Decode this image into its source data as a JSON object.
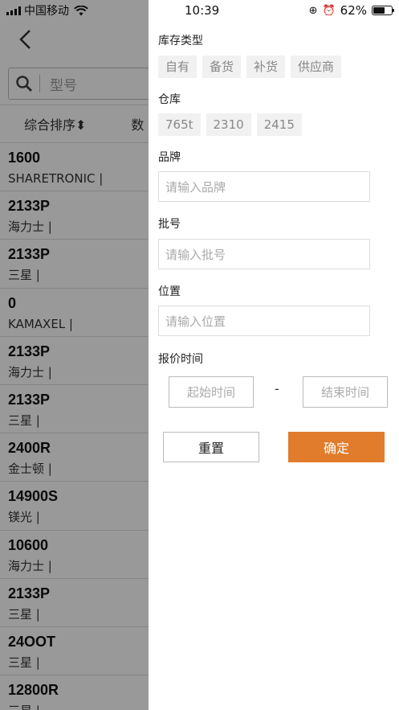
{
  "status_bar": {
    "carrier": "中国移动",
    "time": "10:39",
    "battery": "62%",
    "battery_level": 0.62
  },
  "search": {
    "placeholder": "型号"
  },
  "sort_bar": {
    "primary": "综合排序",
    "secondary": "数"
  },
  "list": [
    {
      "model": "1600",
      "brand": "SHARETRONIC |"
    },
    {
      "model": "2133P",
      "brand": "海力士 |"
    },
    {
      "model": "2133P",
      "brand": "三星 |"
    },
    {
      "model": "0",
      "brand": "KAMAXEL |"
    },
    {
      "model": "2133P",
      "brand": "海力士 |"
    },
    {
      "model": "2133P",
      "brand": "三星 |"
    },
    {
      "model": "2400R",
      "brand": "金士顿 |"
    },
    {
      "model": "14900S",
      "brand": "镁光 |"
    },
    {
      "model": "10600",
      "brand": "海力士 |"
    },
    {
      "model": "2133P",
      "brand": "三星 |"
    },
    {
      "model": "24OOT",
      "brand": "三星 |"
    },
    {
      "model": "12800R",
      "brand": "三星 |"
    }
  ],
  "filter": {
    "stock_type": {
      "title": "库存类型",
      "options": [
        "自有",
        "备货",
        "补货",
        "供应商"
      ]
    },
    "warehouse": {
      "title": "仓库",
      "options": [
        "765t",
        "2310",
        "2415"
      ]
    },
    "brand": {
      "title": "品牌",
      "placeholder": "请输入品牌"
    },
    "batch": {
      "title": "批号",
      "placeholder": "请输入批号"
    },
    "location": {
      "title": "位置",
      "placeholder": "请输入位置"
    },
    "quote_time": {
      "title": "报价时间",
      "start": "起始时间",
      "separator": "-",
      "end": "结束时间"
    },
    "reset_label": "重置",
    "confirm_label": "确定"
  },
  "colors": {
    "accent": "#e07c2c",
    "overlay": "rgba(0,0,0,0.4)"
  }
}
